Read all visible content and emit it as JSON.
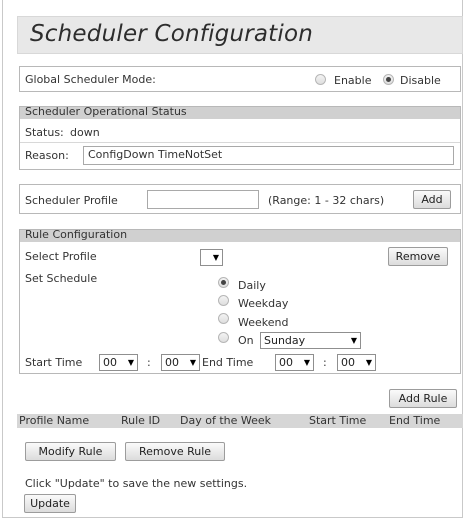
{
  "page": {
    "title": "Scheduler Configuration"
  },
  "global_mode": {
    "label": "Global Scheduler Mode:",
    "enable_label": "Enable",
    "disable_label": "Disable",
    "selected": "Disable"
  },
  "status": {
    "header": "Scheduler Operational Status",
    "status_label": "Status:",
    "status_value": "down",
    "reason_label": "Reason:",
    "reason_value": "ConfigDown  TimeNotSet"
  },
  "profile": {
    "label": "Scheduler Profile",
    "value": "",
    "range_hint": "(Range: 1 - 32 chars)",
    "add_label": "Add"
  },
  "rule_config": {
    "header": "Rule Configuration",
    "select_profile_label": "Select Profile",
    "select_profile_value": "",
    "remove_label": "Remove",
    "set_schedule_label": "Set Schedule",
    "schedule_options": [
      "Daily",
      "Weekday",
      "Weekend",
      "On"
    ],
    "schedule_selected": "Daily",
    "day_value": "Sunday",
    "start_time_label": "Start Time",
    "start_hour": "00",
    "start_min": "00",
    "end_time_label": "End Time",
    "end_hour": "00",
    "end_min": "00",
    "time_sep": ":",
    "add_rule_label": "Add Rule"
  },
  "rules_table": {
    "columns": [
      "Profile Name",
      "Rule ID",
      "Day of the Week",
      "Start Time",
      "End Time"
    ]
  },
  "actions": {
    "modify_label": "Modify Rule",
    "remove_rule_label": "Remove Rule",
    "hint": "Click \"Update\" to save the new settings.",
    "update_label": "Update"
  },
  "colors": {
    "header_gray": "#d0d0d0",
    "title_bg": "#e8e8e8",
    "border": "#b8b8b8"
  }
}
